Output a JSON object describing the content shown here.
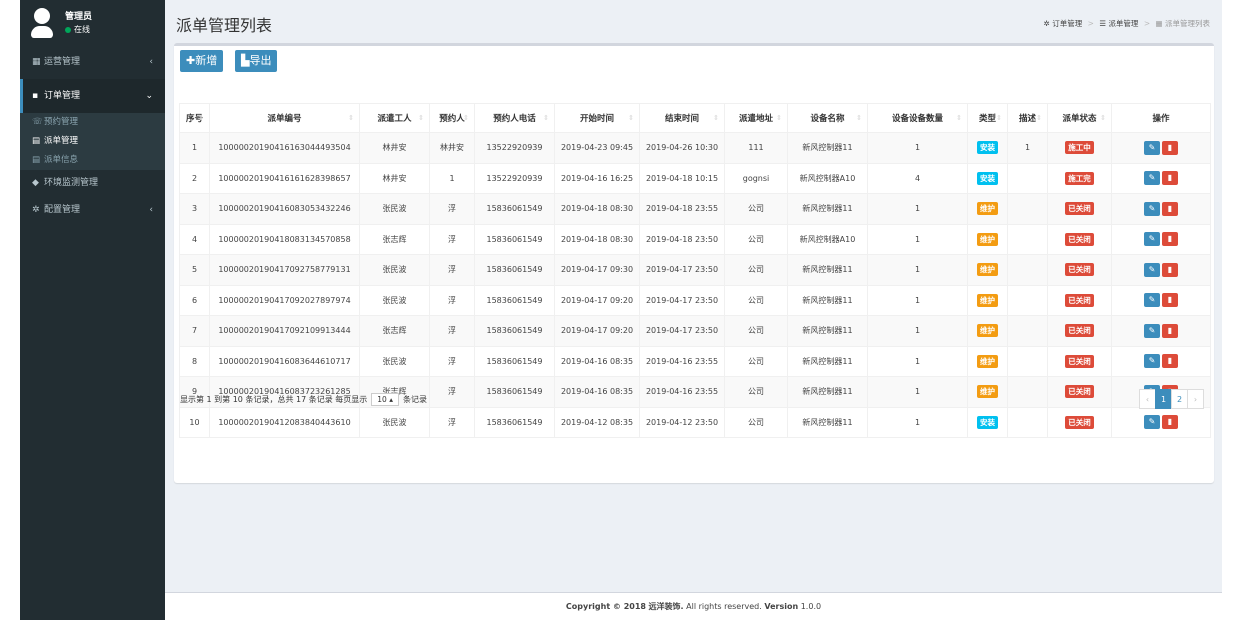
{
  "user": {
    "name": "管理员",
    "status": "在线"
  },
  "sidebar": {
    "items": [
      {
        "label": "运营管理",
        "icon": "dashboard-icon"
      },
      {
        "label": "订单管理",
        "icon": "file-icon"
      },
      {
        "label": "环境监测管理",
        "icon": "tag-icon"
      },
      {
        "label": "配置管理",
        "icon": "gear-icon"
      }
    ],
    "sub_items": [
      {
        "label": "预约管理",
        "icon": "phone-icon"
      },
      {
        "label": "派单管理",
        "icon": "tasks-icon"
      },
      {
        "label": "派单信息",
        "icon": "list-icon"
      }
    ]
  },
  "page": {
    "title": "派单管理列表"
  },
  "breadcrumb": {
    "level1": "订单管理",
    "level2": "派单管理",
    "current": "派单管理列表"
  },
  "toolbar": {
    "add_label": "新增",
    "export_label": "导出"
  },
  "table": {
    "headers": [
      "序号",
      "派单编号",
      "派遣工人",
      "预约人",
      "预约人电话",
      "开始时间",
      "结束时间",
      "派遣地址",
      "设备名称",
      "设备设备数量",
      "类型",
      "描述",
      "派单状态",
      "操作"
    ],
    "rows": [
      [
        "1",
        "10000020190416163044493504",
        "林井安",
        "林井安",
        "13522920939",
        "2019-04-23 09:45",
        "2019-04-26 10:30",
        "111",
        "新风控制器11",
        "1",
        "安装",
        "1",
        "施工中"
      ],
      [
        "2",
        "10000020190416161628398657",
        "林井安",
        "1",
        "13522920939",
        "2019-04-16 16:25",
        "2019-04-18 10:15",
        "gognsi",
        "新风控制器A10",
        "4",
        "安装",
        "",
        "施工完"
      ],
      [
        "3",
        "10000020190416083053432246",
        "张民波",
        "浮",
        "15836061549",
        "2019-04-18 08:30",
        "2019-04-18 23:55",
        "公司",
        "新风控制器11",
        "1",
        "维护",
        "",
        "已关闭"
      ],
      [
        "4",
        "10000020190418083134570858",
        "张志辉",
        "浮",
        "15836061549",
        "2019-04-18 08:30",
        "2019-04-18 23:50",
        "公司",
        "新风控制器A10",
        "1",
        "维护",
        "",
        "已关闭"
      ],
      [
        "5",
        "10000020190417092758779131",
        "张民波",
        "浮",
        "15836061549",
        "2019-04-17 09:30",
        "2019-04-17 23:50",
        "公司",
        "新风控制器11",
        "1",
        "维护",
        "",
        "已关闭"
      ],
      [
        "6",
        "10000020190417092027897974",
        "张民波",
        "浮",
        "15836061549",
        "2019-04-17 09:20",
        "2019-04-17 23:50",
        "公司",
        "新风控制器11",
        "1",
        "维护",
        "",
        "已关闭"
      ],
      [
        "7",
        "10000020190417092109913444",
        "张志辉",
        "浮",
        "15836061549",
        "2019-04-17 09:20",
        "2019-04-17 23:50",
        "公司",
        "新风控制器11",
        "1",
        "维护",
        "",
        "已关闭"
      ],
      [
        "8",
        "10000020190416083644610717",
        "张民波",
        "浮",
        "15836061549",
        "2019-04-16 08:35",
        "2019-04-16 23:55",
        "公司",
        "新风控制器11",
        "1",
        "维护",
        "",
        "已关闭"
      ],
      [
        "9",
        "10000020190416083723261285",
        "张志辉",
        "浮",
        "15836061549",
        "2019-04-16 08:35",
        "2019-04-16 23:55",
        "公司",
        "新风控制器11",
        "1",
        "维护",
        "",
        "已关闭"
      ],
      [
        "10",
        "10000020190412083840443610",
        "张民波",
        "浮",
        "15836061549",
        "2019-04-12 08:35",
        "2019-04-12 23:50",
        "公司",
        "新风控制器11",
        "1",
        "安装",
        "",
        "已关闭"
      ]
    ]
  },
  "colors": {
    "type": {
      "安装": "#00c0ef",
      "维护": "#f39c12"
    },
    "status": "#dd4b39",
    "edit": "#3c8dbc",
    "delete": "#dd4b39"
  },
  "pagination": {
    "info_prefix": "显示第 1 到第 10 条记录，总共 17 条记录 每页显示",
    "page_size": "10",
    "info_suffix": "条记录",
    "pages": [
      "1",
      "2"
    ],
    "prev": "‹",
    "next": "›"
  },
  "footer": {
    "copyright": "Copyright © 2018",
    "company": "远洋装饰.",
    "rights": "All rights reserved.",
    "version_label": "Version",
    "version": "1.0.0"
  }
}
